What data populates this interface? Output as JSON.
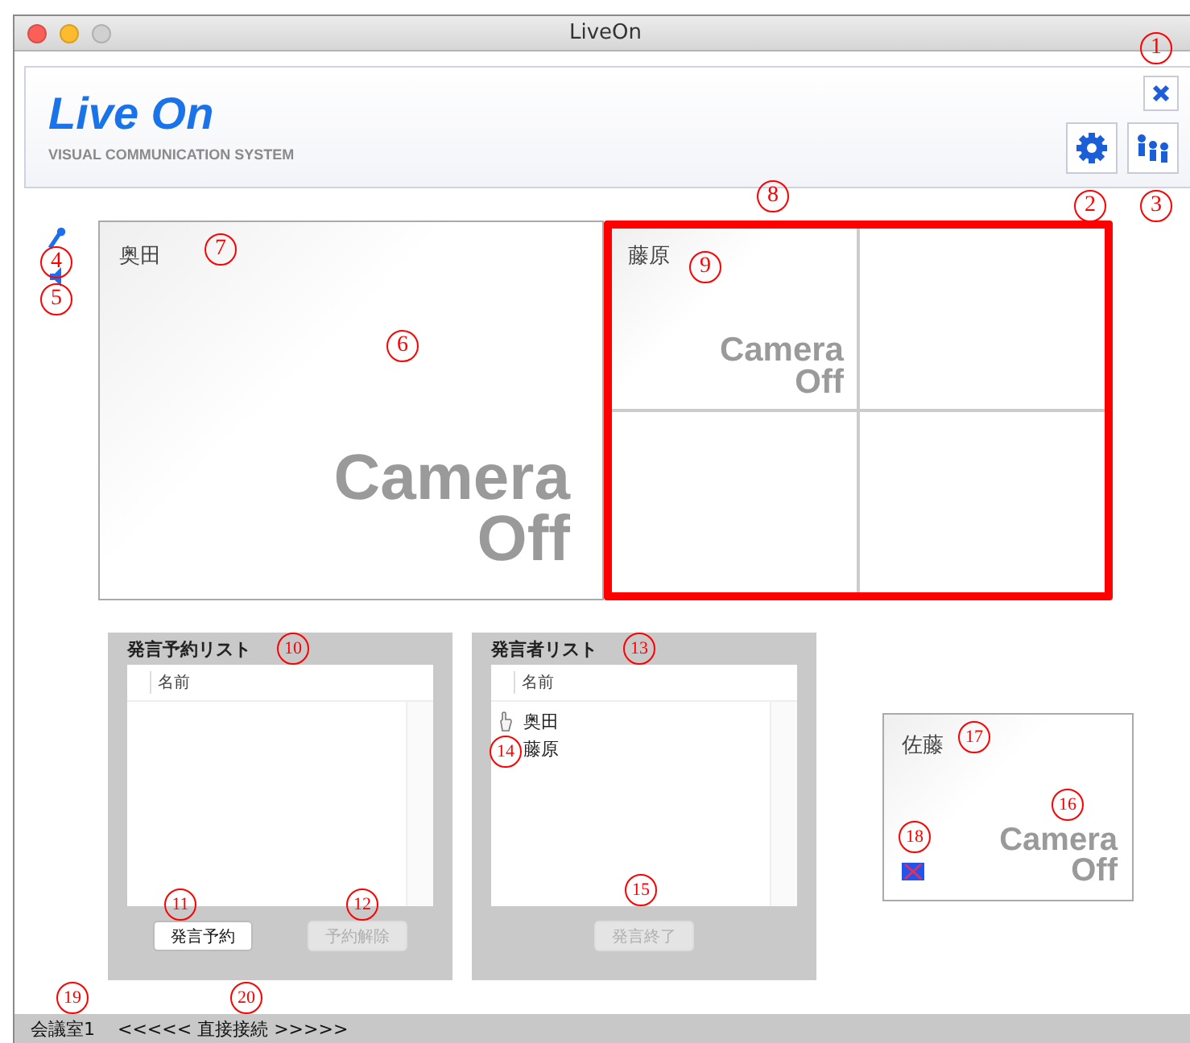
{
  "window": {
    "title": "LiveOn"
  },
  "header": {
    "logo": "Live On",
    "tagline": "VISUAL COMMUNICATION SYSTEM"
  },
  "main_video": {
    "name": "奥田",
    "camera_lines": [
      "Camera",
      "Off"
    ]
  },
  "video_grid": {
    "highlighted": true,
    "tiles": [
      {
        "kind": "camera",
        "name": "藤原",
        "camera_lines": [
          "Camera",
          "Off"
        ]
      },
      {
        "kind": "empty"
      },
      {
        "kind": "empty"
      },
      {
        "kind": "empty"
      }
    ]
  },
  "reservation_panel": {
    "title": "発言予約リスト",
    "column": "名前",
    "buttons": [
      {
        "label": "発言予約",
        "disabled": false
      },
      {
        "label": "予約解除",
        "disabled": true
      }
    ]
  },
  "speaker_panel": {
    "title": "発言者リスト",
    "column": "名前",
    "rows": [
      {
        "name": "奥田",
        "raised_hand": true
      },
      {
        "name": "藤原",
        "raised_hand": false
      }
    ],
    "buttons": [
      {
        "label": "発言終了",
        "disabled": true
      }
    ]
  },
  "self_video": {
    "name": "佐藤",
    "camera_lines": [
      "Camera",
      "Off"
    ],
    "mic_muted": true
  },
  "status_bar": {
    "room": "会議室1",
    "connection": "<<<<< 直接接続 >>>>>"
  },
  "annotations": [
    "1",
    "2",
    "3",
    "4",
    "5",
    "6",
    "7",
    "8",
    "9",
    "10",
    "11",
    "12",
    "13",
    "14",
    "15",
    "16",
    "17",
    "18",
    "19",
    "20"
  ]
}
